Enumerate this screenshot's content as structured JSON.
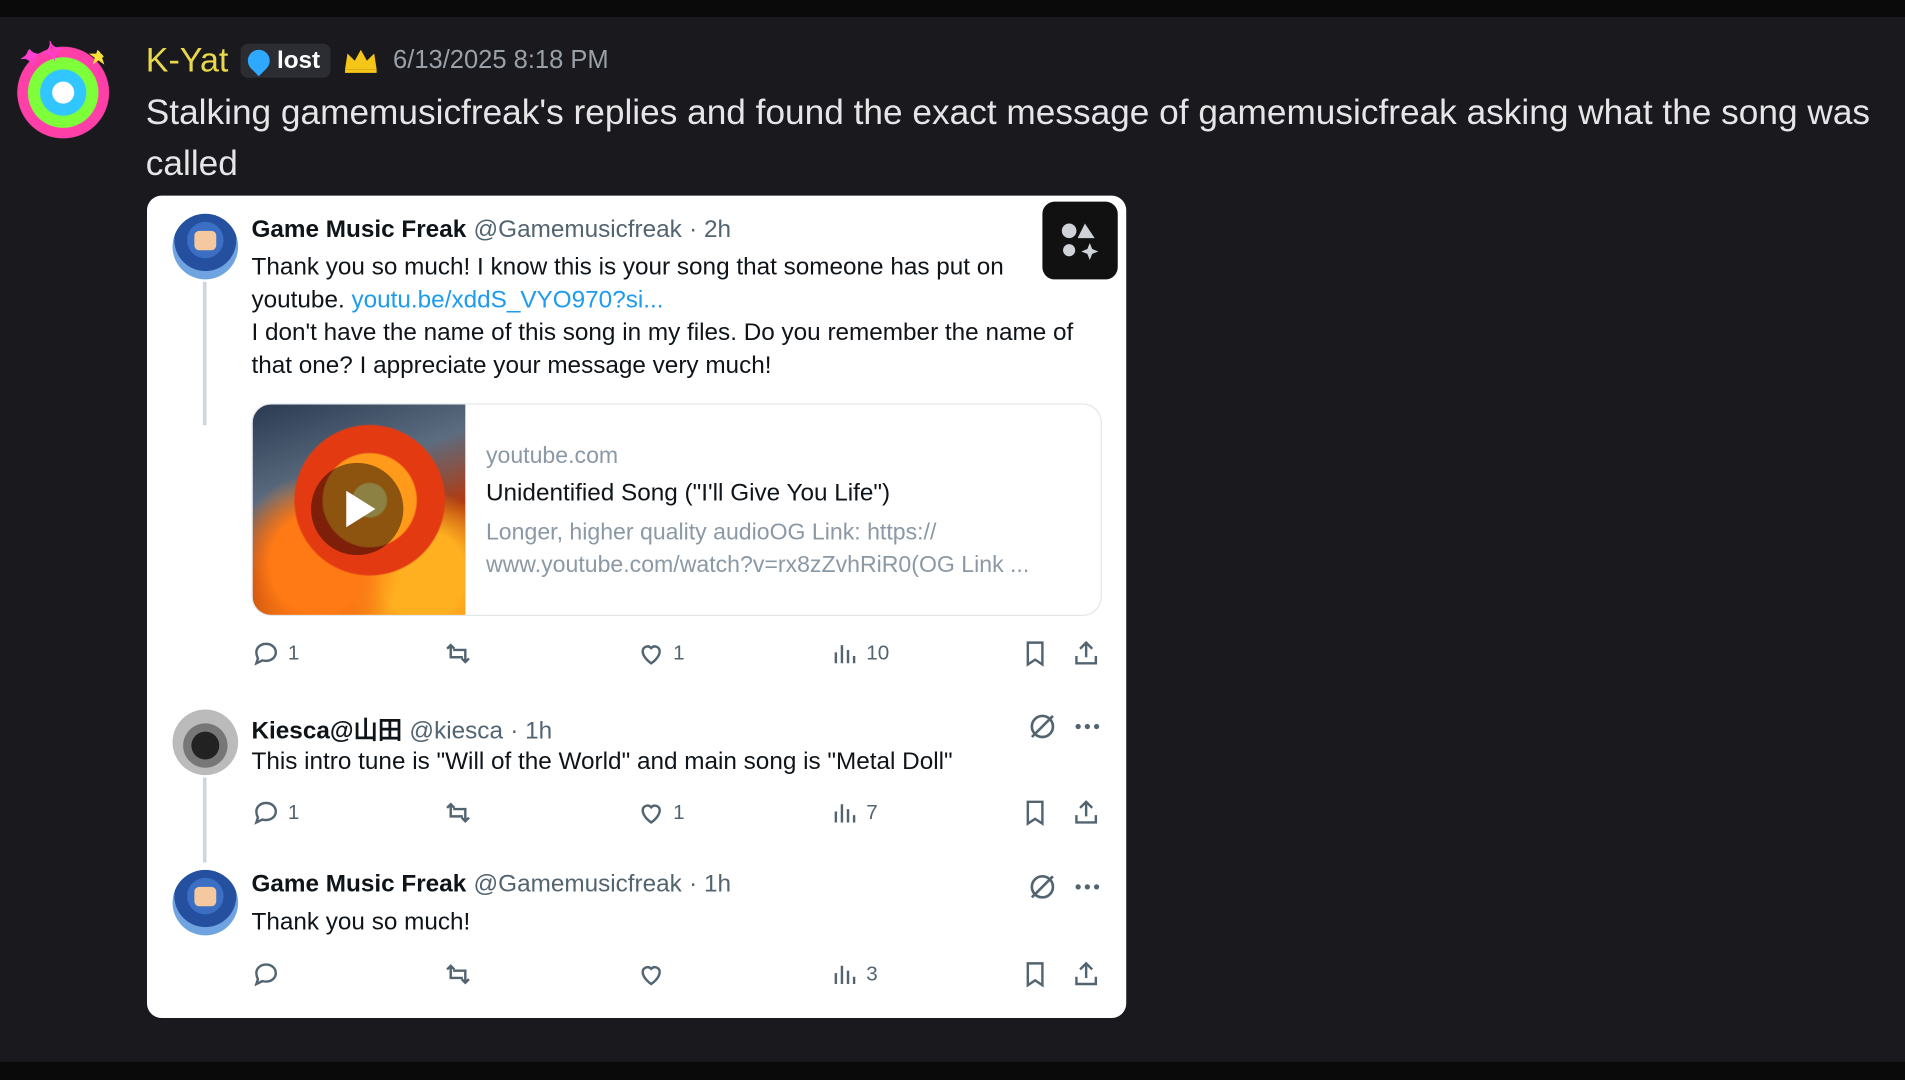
{
  "message": {
    "username": "K-Yat",
    "role_tag": "lost",
    "timestamp": "6/13/2025 8:18 PM",
    "text": "Stalking gamemusicfreak's replies and found the exact message of gamemusicfreak asking what the song was called"
  },
  "tweets": [
    {
      "name": "Game Music Freak",
      "handle": "@Gamemusicfreak",
      "time": "· 2h",
      "body_line1": "Thank you so much! I know this is your song that someone has put on",
      "body_line2_prefix": "youtube.",
      "link": "youtu.be/xddS_VYO970?si...",
      "body_line3": "I don't have the name of this song in my files. Do you remember the name of that one? I appreciate your message very much!",
      "card": {
        "domain": "youtube.com",
        "title": "Unidentified Song (\"I'll Give You Life\")",
        "description": "Longer, higher quality audioOG Link: https:// www.youtube.com/watch?v=rx8zZvhRiR0(OG Link ..."
      },
      "replies": "1",
      "likes": "1",
      "views": "10"
    },
    {
      "name": "Kiesca@山田",
      "handle": "@kiesca",
      "time": "· 1h",
      "body": "This intro tune is \"Will of the World\" and main song is \"Metal Doll\"",
      "replies": "1",
      "likes": "1",
      "views": "7"
    },
    {
      "name": "Game Music Freak",
      "handle": "@Gamemusicfreak",
      "time": "· 1h",
      "body": "Thank you so much!",
      "views": "3"
    }
  ]
}
